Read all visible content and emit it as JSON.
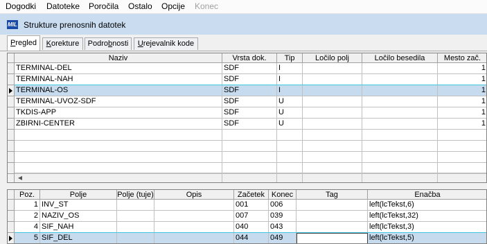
{
  "menu": {
    "items": [
      "Dogodki",
      "Datoteke",
      "Poročila",
      "Ostalo",
      "Opcije",
      "Konec"
    ],
    "disabled": [
      false,
      false,
      false,
      false,
      false,
      true
    ]
  },
  "window": {
    "title": "Strukture prenosnih datotek",
    "icon_text": "MIL",
    "icon": "app-logo-icon"
  },
  "tabs": [
    {
      "label": "Pregled",
      "mnemonic": "P",
      "active": true
    },
    {
      "label": "Korekture",
      "mnemonic": "K",
      "active": false
    },
    {
      "label": "Podrobnosti",
      "mnemonic": "b",
      "active": false
    },
    {
      "label": "Urejevalnik kode",
      "mnemonic": "U",
      "active": false
    }
  ],
  "files_table": {
    "columns": [
      "Naziv",
      "Vrsta dok.",
      "Tip",
      "Ločilo polj",
      "Ločilo besedila",
      "Mesto zač."
    ],
    "rows": [
      [
        "TERMINAL-DEL",
        "SDF",
        "I",
        "",
        "",
        "1"
      ],
      [
        "TERMINAL-NAH",
        "SDF",
        "I",
        "",
        "",
        "1"
      ],
      [
        "TERMINAL-OS",
        "SDF",
        "I",
        "",
        "",
        "1"
      ],
      [
        "TERMINAL-UVOZ-SDF",
        "SDF",
        "U",
        "",
        "",
        "1"
      ],
      [
        "TKDIS-APP",
        "SDF",
        "U",
        "",
        "",
        "1"
      ],
      [
        "ZBIRNI-CENTER",
        "SDF",
        "U",
        "",
        "",
        "1"
      ]
    ],
    "selected_row": 2,
    "empty_rows": 5
  },
  "fields_table": {
    "columns": [
      "Poz.",
      "Polje",
      "Polje (tuje)",
      "Opis",
      "Začetek",
      "Konec",
      "Tag",
      "Enačba"
    ],
    "rows": [
      [
        "1",
        "INV_ST",
        "",
        "",
        "001",
        "006",
        "",
        "left(lcTekst,6)"
      ],
      [
        "2",
        "NAZIV_OS",
        "",
        "",
        "007",
        "039",
        "",
        "left(lcTekst,32)"
      ],
      [
        "4",
        "SIF_NAH",
        "",
        "",
        "040",
        "043",
        "",
        "left(lcTekst,3)"
      ],
      [
        "5",
        "SIF_DEL",
        "",
        "",
        "044",
        "049",
        "",
        "left(lcTekst,5)"
      ]
    ],
    "selected_row": 3
  },
  "colors": {
    "selection": "#c6dbee",
    "selection_border": "#3ec7dd",
    "titlebar": "#c9dcf0"
  }
}
